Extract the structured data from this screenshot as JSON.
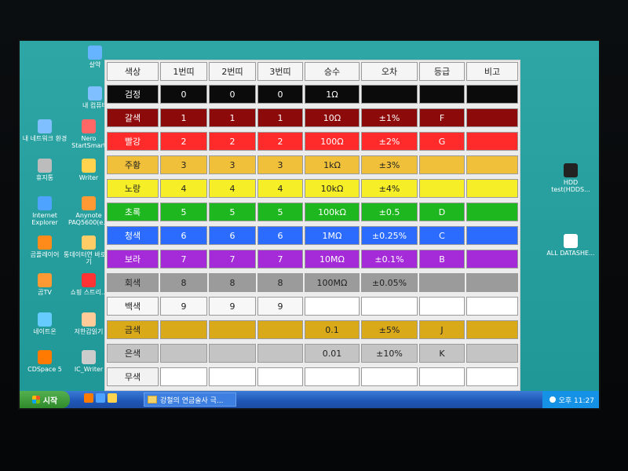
{
  "desktop_icons": [
    {
      "label": "살약",
      "color": "#66b3ff"
    },
    {
      "label": "내 컴퓨터",
      "color": "#7fbfff"
    },
    {
      "label": "내 네트워크 환경",
      "color": "#7fbfff"
    },
    {
      "label": "Nero StartSmart",
      "color": "#ff6666"
    },
    {
      "label": "휴지통",
      "color": "#bcbcbc"
    },
    {
      "label": "Writer",
      "color": "#ffd34d"
    },
    {
      "label": "Internet Explorer",
      "color": "#4da3ff"
    },
    {
      "label": "Anynote PAQ5600(e...",
      "color": "#ff9933"
    },
    {
      "label": "곰플레이어",
      "color": "#ff8c1a"
    },
    {
      "label": "통데이터연 바로 가기",
      "color": "#ffcc66"
    },
    {
      "label": "곰TV",
      "color": "#ff9933"
    },
    {
      "label": "쇼핑 스트리...",
      "color": "#ff3333"
    },
    {
      "label": "네이트온",
      "color": "#66ccff"
    },
    {
      "label": "저한갑읽기",
      "color": "#ffcc99"
    },
    {
      "label": "CDSpace 5",
      "color": "#ff7a00"
    },
    {
      "label": "IC_Writer",
      "color": "#cccccc"
    },
    {
      "label": "HDD test(HDDS...",
      "color": "#222222"
    },
    {
      "label": "ALL DATASHE...",
      "color": "#ffffff"
    }
  ],
  "table": {
    "headers": [
      "색상",
      "1번띠",
      "2번띠",
      "3번띠",
      "승수",
      "오차",
      "등급",
      "비고"
    ],
    "rows": [
      {
        "color_name": "검정",
        "swatch": "#0b0b0b",
        "text": "#ffffff",
        "b1": "0",
        "b2": "0",
        "b3": "0",
        "mult": "1Ω",
        "tol": "",
        "grade": "",
        "note": ""
      },
      {
        "color_name": "갈색",
        "swatch": "#8c0a0a",
        "text": "#ffffff",
        "b1": "1",
        "b2": "1",
        "b3": "1",
        "mult": "10Ω",
        "tol": "±1%",
        "grade": "F",
        "note": ""
      },
      {
        "color_name": "빨강",
        "swatch": "#ff2a2a",
        "text": "#ffffff",
        "b1": "2",
        "b2": "2",
        "b3": "2",
        "mult": "100Ω",
        "tol": "±2%",
        "grade": "G",
        "note": ""
      },
      {
        "color_name": "주황",
        "swatch": "#f0c03a",
        "text": "#222222",
        "b1": "3",
        "b2": "3",
        "b3": "3",
        "mult": "1kΩ",
        "tol": "±3%",
        "grade": "",
        "note": ""
      },
      {
        "color_name": "노랑",
        "swatch": "#f6ee27",
        "text": "#222222",
        "b1": "4",
        "b2": "4",
        "b3": "4",
        "mult": "10kΩ",
        "tol": "±4%",
        "grade": "",
        "note": ""
      },
      {
        "color_name": "초록",
        "swatch": "#1fb71f",
        "text": "#ffffff",
        "b1": "5",
        "b2": "5",
        "b3": "5",
        "mult": "100kΩ",
        "tol": "±0.5",
        "grade": "D",
        "note": ""
      },
      {
        "color_name": "청색",
        "swatch": "#2b6cff",
        "text": "#ffffff",
        "b1": "6",
        "b2": "6",
        "b3": "6",
        "mult": "1MΩ",
        "tol": "±0.25%",
        "grade": "C",
        "note": ""
      },
      {
        "color_name": "보라",
        "swatch": "#a52bd9",
        "text": "#ffffff",
        "b1": "7",
        "b2": "7",
        "b3": "7",
        "mult": "10MΩ",
        "tol": "±0.1%",
        "grade": "B",
        "note": ""
      },
      {
        "color_name": "회색",
        "swatch": "#9b9b9b",
        "text": "#222222",
        "b1": "8",
        "b2": "8",
        "b3": "8",
        "mult": "100MΩ",
        "tol": "±0.05%",
        "grade": "",
        "note": ""
      },
      {
        "color_name": "백색",
        "swatch": "#f7f7f7",
        "text": "#222222",
        "b1": "9",
        "b2": "9",
        "b3": "9",
        "mult": "",
        "tol": "",
        "grade": "",
        "note": ""
      },
      {
        "color_name": "금색",
        "swatch": "#d9a91a",
        "text": "#222222",
        "b1": "",
        "b2": "",
        "b3": "",
        "mult": "0.1",
        "tol": "±5%",
        "grade": "J",
        "note": ""
      },
      {
        "color_name": "은색",
        "swatch": "#c4c4c4",
        "text": "#222222",
        "b1": "",
        "b2": "",
        "b3": "",
        "mult": "0.01",
        "tol": "±10%",
        "grade": "K",
        "note": ""
      },
      {
        "color_name": "무색",
        "swatch": "#f2f2f2",
        "text": "#222222",
        "b1": "",
        "b2": "",
        "b3": "",
        "mult": "",
        "tol": "",
        "grade": "",
        "note": ""
      }
    ]
  },
  "taskbar": {
    "start_label": "시작",
    "task_label": "강철의 연금술사 극...",
    "tray_label": "오후 11:27"
  }
}
